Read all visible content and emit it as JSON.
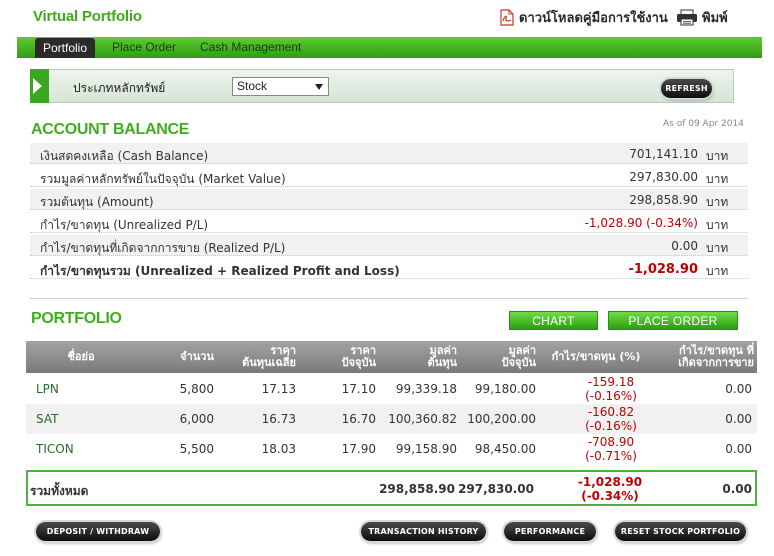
{
  "header": {
    "title": "Virtual Portfolio",
    "manual_label": "ดาวน์โหลดคู่มือการใช้งาน",
    "print_label": "พิมพ์"
  },
  "nav": {
    "tabs": [
      {
        "label": "Portfolio",
        "active": true
      },
      {
        "label": "Place Order",
        "active": false
      },
      {
        "label": "Cash Management",
        "active": false
      }
    ]
  },
  "filter": {
    "label": "ประเภทหลักทรัพย์",
    "selected": "Stock",
    "refresh_label": "REFRESH"
  },
  "account_balance": {
    "title": "ACCOUNT BALANCE",
    "as_of": "As of 09 Apr 2014",
    "unit": "บาท",
    "rows": [
      {
        "label": "เงินสดคงเหลือ (Cash Balance)",
        "value": "701,141.10"
      },
      {
        "label": "รวมมูลค่าหลักทรัพย์ในปัจจุบัน (Market Value)",
        "value": "297,830.00"
      },
      {
        "label": "รวมต้นทุน (Amount)",
        "value": "298,858.90"
      },
      {
        "label": "กำไร/ขาดทุน (Unrealized P/L)",
        "value": "-1,028.90 (-0.34%)"
      },
      {
        "label": "กำไร/ขาดทุนที่เกิดจากการขาย (Realized P/L)",
        "value": "0.00"
      },
      {
        "label": "กำไร/ขาดทุนรวม (Unrealized + Realized Profit and Loss)",
        "value": "-1,028.90"
      }
    ]
  },
  "portfolio": {
    "title": "PORTFOLIO",
    "chart_label": "CHART",
    "place_order_label": "PLACE ORDER",
    "columns": {
      "symbol": "ชื่อย่อ",
      "qty": "จำนวน",
      "avg_cost_1": "ราคา",
      "avg_cost_2": "ต้นทุนเฉลี่ย",
      "price_1": "ราคา",
      "price_2": "ปัจจุบัน",
      "cost_1": "มูลค่า",
      "cost_2": "ต้นทุน",
      "market_1": "มูลค่า",
      "market_2": "ปัจจุบัน",
      "pl": "กำไร/ขาดทุน (%)",
      "realized_1": "กำไร/ขาดทุน ที่",
      "realized_2": "เกิดจากการขาย"
    },
    "rows": [
      {
        "symbol": "LPN",
        "qty": "5,800",
        "avg_cost": "17.13",
        "price": "17.10",
        "cost": "99,339.18",
        "market": "99,180.00",
        "pl_value": "-159.18",
        "pl_pct": "(-0.16%)",
        "realized": "0.00"
      },
      {
        "symbol": "SAT",
        "qty": "6,000",
        "avg_cost": "16.73",
        "price": "16.70",
        "cost": "100,360.82",
        "market": "100,200.00",
        "pl_value": "-160.82",
        "pl_pct": "(-0.16%)",
        "realized": "0.00"
      },
      {
        "symbol": "TICON",
        "qty": "5,500",
        "avg_cost": "18.03",
        "price": "17.90",
        "cost": "99,158.90",
        "market": "98,450.00",
        "pl_value": "-708.90",
        "pl_pct": "(-0.71%)",
        "realized": "0.00"
      }
    ],
    "total": {
      "label": "รวมทั้งหมด",
      "cost": "298,858.90",
      "market": "297,830.00",
      "pl_value": "-1,028.90",
      "pl_pct": "(-0.34%)",
      "realized": "0.00"
    }
  },
  "footer": {
    "deposit_label": "DEPOSIT / WITHDRAW",
    "history_label": "TRANSACTION HISTORY",
    "performance_label": "PERFORMANCE",
    "reset_label": "RESET STOCK PORTFOLIO"
  },
  "colors": {
    "brand_green": "#3fae1e",
    "negative_red": "#c00000",
    "header_gray": "#8f8f8f"
  }
}
